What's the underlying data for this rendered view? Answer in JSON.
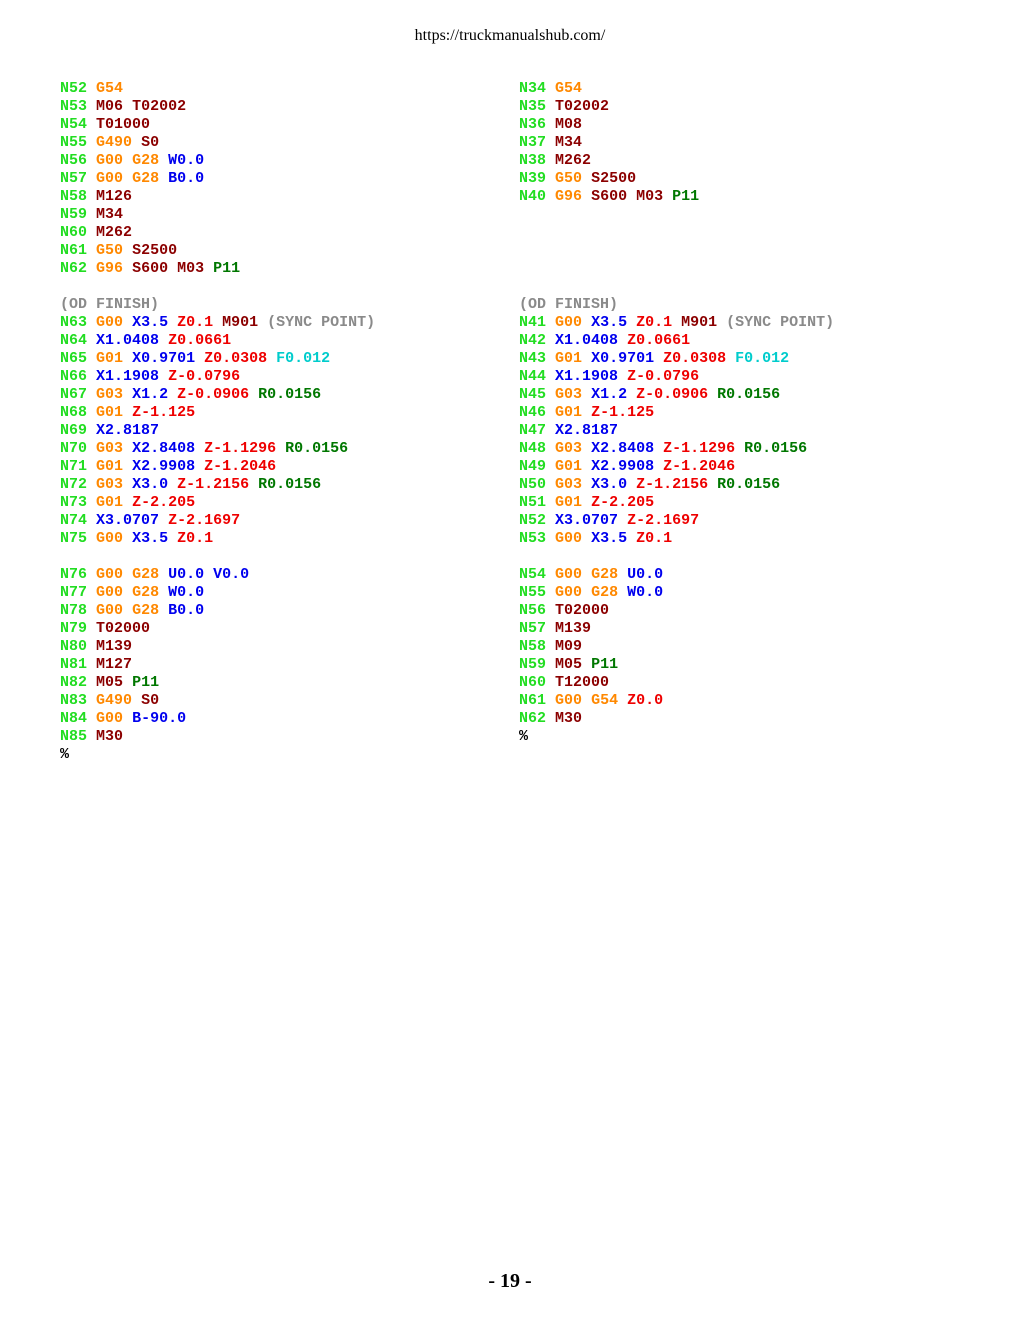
{
  "header": {
    "url": "https://truckmanualshub.com/"
  },
  "colors": {
    "n": "#22dd22",
    "g": "#ff8800",
    "m": "#8b0000",
    "ax": "#0000ee",
    "az": "#ee0000",
    "r": "#007700",
    "f": "#00cccc",
    "c": "#8a8a8a",
    "p": "#000000"
  },
  "left_code": [
    [
      [
        "n",
        "N52"
      ],
      [
        "g",
        "G54"
      ]
    ],
    [
      [
        "n",
        "N53"
      ],
      [
        "m",
        "M06"
      ],
      [
        "m",
        "T02002"
      ]
    ],
    [
      [
        "n",
        "N54"
      ],
      [
        "m",
        "T01000"
      ]
    ],
    [
      [
        "n",
        "N55"
      ],
      [
        "g",
        "G490"
      ],
      [
        "m",
        "S0"
      ]
    ],
    [
      [
        "n",
        "N56"
      ],
      [
        "g",
        "G00"
      ],
      [
        "g",
        "G28"
      ],
      [
        "ax",
        "W0.0"
      ]
    ],
    [
      [
        "n",
        "N57"
      ],
      [
        "g",
        "G00"
      ],
      [
        "g",
        "G28"
      ],
      [
        "ax",
        "B0.0"
      ]
    ],
    [
      [
        "n",
        "N58"
      ],
      [
        "m",
        "M126"
      ]
    ],
    [
      [
        "n",
        "N59"
      ],
      [
        "m",
        "M34"
      ]
    ],
    [
      [
        "n",
        "N60"
      ],
      [
        "m",
        "M262"
      ]
    ],
    [
      [
        "n",
        "N61"
      ],
      [
        "g",
        "G50"
      ],
      [
        "m",
        "S2500"
      ]
    ],
    [
      [
        "n",
        "N62"
      ],
      [
        "g",
        "G96"
      ],
      [
        "m",
        "S600"
      ],
      [
        "m",
        "M03"
      ],
      [
        "r",
        "P11"
      ]
    ],
    [],
    [
      [
        "c",
        "(OD FINISH)"
      ]
    ],
    [
      [
        "n",
        "N63"
      ],
      [
        "g",
        "G00"
      ],
      [
        "ax",
        "X3.5"
      ],
      [
        "az",
        "Z0.1"
      ],
      [
        "m",
        "M901"
      ],
      [
        "c",
        "(SYNC POINT)"
      ]
    ],
    [
      [
        "n",
        "N64"
      ],
      [
        "ax",
        "X1.0408"
      ],
      [
        "az",
        "Z0.0661"
      ]
    ],
    [
      [
        "n",
        "N65"
      ],
      [
        "g",
        "G01"
      ],
      [
        "ax",
        "X0.9701"
      ],
      [
        "az",
        "Z0.0308"
      ],
      [
        "f",
        "F0.012"
      ]
    ],
    [
      [
        "n",
        "N66"
      ],
      [
        "ax",
        "X1.1908"
      ],
      [
        "az",
        "Z-0.0796"
      ]
    ],
    [
      [
        "n",
        "N67"
      ],
      [
        "g",
        "G03"
      ],
      [
        "ax",
        "X1.2"
      ],
      [
        "az",
        "Z-0.0906"
      ],
      [
        "r",
        "R0.0156"
      ]
    ],
    [
      [
        "n",
        "N68"
      ],
      [
        "g",
        "G01"
      ],
      [
        "az",
        "Z-1.125"
      ]
    ],
    [
      [
        "n",
        "N69"
      ],
      [
        "ax",
        "X2.8187"
      ]
    ],
    [
      [
        "n",
        "N70"
      ],
      [
        "g",
        "G03"
      ],
      [
        "ax",
        "X2.8408"
      ],
      [
        "az",
        "Z-1.1296"
      ],
      [
        "r",
        "R0.0156"
      ]
    ],
    [
      [
        "n",
        "N71"
      ],
      [
        "g",
        "G01"
      ],
      [
        "ax",
        "X2.9908"
      ],
      [
        "az",
        "Z-1.2046"
      ]
    ],
    [
      [
        "n",
        "N72"
      ],
      [
        "g",
        "G03"
      ],
      [
        "ax",
        "X3.0"
      ],
      [
        "az",
        "Z-1.2156"
      ],
      [
        "r",
        "R0.0156"
      ]
    ],
    [
      [
        "n",
        "N73"
      ],
      [
        "g",
        "G01"
      ],
      [
        "az",
        "Z-2.205"
      ]
    ],
    [
      [
        "n",
        "N74"
      ],
      [
        "ax",
        "X3.0707"
      ],
      [
        "az",
        "Z-2.1697"
      ]
    ],
    [
      [
        "n",
        "N75"
      ],
      [
        "g",
        "G00"
      ],
      [
        "ax",
        "X3.5"
      ],
      [
        "az",
        "Z0.1"
      ]
    ],
    [],
    [
      [
        "n",
        "N76"
      ],
      [
        "g",
        "G00"
      ],
      [
        "g",
        "G28"
      ],
      [
        "ax",
        "U0.0"
      ],
      [
        "ax",
        "V0.0"
      ]
    ],
    [
      [
        "n",
        "N77"
      ],
      [
        "g",
        "G00"
      ],
      [
        "g",
        "G28"
      ],
      [
        "ax",
        "W0.0"
      ]
    ],
    [
      [
        "n",
        "N78"
      ],
      [
        "g",
        "G00"
      ],
      [
        "g",
        "G28"
      ],
      [
        "ax",
        "B0.0"
      ]
    ],
    [
      [
        "n",
        "N79"
      ],
      [
        "m",
        "T02000"
      ]
    ],
    [
      [
        "n",
        "N80"
      ],
      [
        "m",
        "M139"
      ]
    ],
    [
      [
        "n",
        "N81"
      ],
      [
        "m",
        "M127"
      ]
    ],
    [
      [
        "n",
        "N82"
      ],
      [
        "m",
        "M05"
      ],
      [
        "r",
        "P11"
      ]
    ],
    [
      [
        "n",
        "N83"
      ],
      [
        "g",
        "G490"
      ],
      [
        "m",
        "S0"
      ]
    ],
    [
      [
        "n",
        "N84"
      ],
      [
        "g",
        "G00"
      ],
      [
        "ax",
        "B-90.0"
      ]
    ],
    [
      [
        "n",
        "N85"
      ],
      [
        "m",
        "M30"
      ]
    ],
    [
      [
        "p",
        "%"
      ]
    ]
  ],
  "right_code": [
    [
      [
        "n",
        "N34"
      ],
      [
        "g",
        "G54"
      ]
    ],
    [
      [
        "n",
        "N35"
      ],
      [
        "m",
        "T02002"
      ]
    ],
    [
      [
        "n",
        "N36"
      ],
      [
        "m",
        "M08"
      ]
    ],
    [
      [
        "n",
        "N37"
      ],
      [
        "m",
        "M34"
      ]
    ],
    [
      [
        "n",
        "N38"
      ],
      [
        "m",
        "M262"
      ]
    ],
    [
      [
        "n",
        "N39"
      ],
      [
        "g",
        "G50"
      ],
      [
        "m",
        "S2500"
      ]
    ],
    [
      [
        "n",
        "N40"
      ],
      [
        "g",
        "G96"
      ],
      [
        "m",
        "S600"
      ],
      [
        "m",
        "M03"
      ],
      [
        "r",
        "P11"
      ]
    ],
    [],
    [],
    [],
    [],
    [],
    [
      [
        "c",
        "(OD FINISH)"
      ]
    ],
    [
      [
        "n",
        "N41"
      ],
      [
        "g",
        "G00"
      ],
      [
        "ax",
        "X3.5"
      ],
      [
        "az",
        "Z0.1"
      ],
      [
        "m",
        "M901"
      ],
      [
        "c",
        "(SYNC POINT)"
      ]
    ],
    [
      [
        "n",
        "N42"
      ],
      [
        "ax",
        "X1.0408"
      ],
      [
        "az",
        "Z0.0661"
      ]
    ],
    [
      [
        "n",
        "N43"
      ],
      [
        "g",
        "G01"
      ],
      [
        "ax",
        "X0.9701"
      ],
      [
        "az",
        "Z0.0308"
      ],
      [
        "f",
        "F0.012"
      ]
    ],
    [
      [
        "n",
        "N44"
      ],
      [
        "ax",
        "X1.1908"
      ],
      [
        "az",
        "Z-0.0796"
      ]
    ],
    [
      [
        "n",
        "N45"
      ],
      [
        "g",
        "G03"
      ],
      [
        "ax",
        "X1.2"
      ],
      [
        "az",
        "Z-0.0906"
      ],
      [
        "r",
        "R0.0156"
      ]
    ],
    [
      [
        "n",
        "N46"
      ],
      [
        "g",
        "G01"
      ],
      [
        "az",
        "Z-1.125"
      ]
    ],
    [
      [
        "n",
        "N47"
      ],
      [
        "ax",
        "X2.8187"
      ]
    ],
    [
      [
        "n",
        "N48"
      ],
      [
        "g",
        "G03"
      ],
      [
        "ax",
        "X2.8408"
      ],
      [
        "az",
        "Z-1.1296"
      ],
      [
        "r",
        "R0.0156"
      ]
    ],
    [
      [
        "n",
        "N49"
      ],
      [
        "g",
        "G01"
      ],
      [
        "ax",
        "X2.9908"
      ],
      [
        "az",
        "Z-1.2046"
      ]
    ],
    [
      [
        "n",
        "N50"
      ],
      [
        "g",
        "G03"
      ],
      [
        "ax",
        "X3.0"
      ],
      [
        "az",
        "Z-1.2156"
      ],
      [
        "r",
        "R0.0156"
      ]
    ],
    [
      [
        "n",
        "N51"
      ],
      [
        "g",
        "G01"
      ],
      [
        "az",
        "Z-2.205"
      ]
    ],
    [
      [
        "n",
        "N52"
      ],
      [
        "ax",
        "X3.0707"
      ],
      [
        "az",
        "Z-2.1697"
      ]
    ],
    [
      [
        "n",
        "N53"
      ],
      [
        "g",
        "G00"
      ],
      [
        "ax",
        "X3.5"
      ],
      [
        "az",
        "Z0.1"
      ]
    ],
    [],
    [
      [
        "n",
        "N54"
      ],
      [
        "g",
        "G00"
      ],
      [
        "g",
        "G28"
      ],
      [
        "ax",
        "U0.0"
      ]
    ],
    [
      [
        "n",
        "N55"
      ],
      [
        "g",
        "G00"
      ],
      [
        "g",
        "G28"
      ],
      [
        "ax",
        "W0.0"
      ]
    ],
    [
      [
        "n",
        "N56"
      ],
      [
        "m",
        "T02000"
      ]
    ],
    [
      [
        "n",
        "N57"
      ],
      [
        "m",
        "M139"
      ]
    ],
    [
      [
        "n",
        "N58"
      ],
      [
        "m",
        "M09"
      ]
    ],
    [
      [
        "n",
        "N59"
      ],
      [
        "m",
        "M05"
      ],
      [
        "r",
        "P11"
      ]
    ],
    [
      [
        "n",
        "N60"
      ],
      [
        "m",
        "T12000"
      ]
    ],
    [
      [
        "n",
        "N61"
      ],
      [
        "g",
        "G00"
      ],
      [
        "g",
        "G54"
      ],
      [
        "az",
        "Z0.0"
      ]
    ],
    [
      [
        "n",
        "N62"
      ],
      [
        "m",
        "M30"
      ]
    ],
    [
      [
        "p",
        "%"
      ]
    ]
  ],
  "footer": {
    "page_number": "- 19 -"
  }
}
